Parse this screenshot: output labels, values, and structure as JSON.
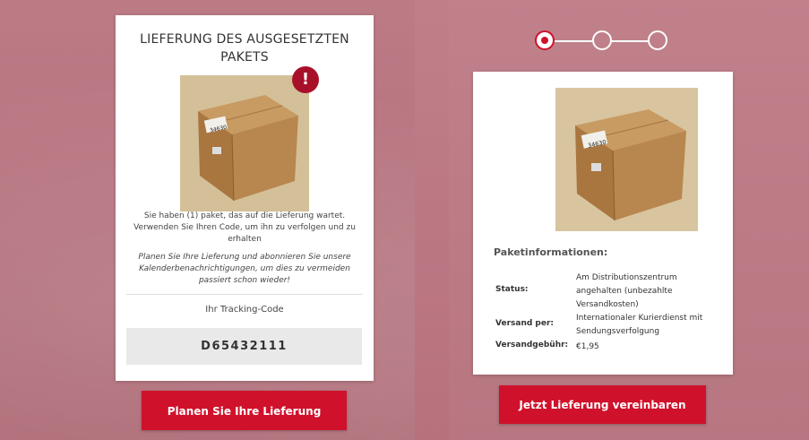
{
  "left_card": {
    "title": "LIEFERUNG DES AUSGESETZTEN PAKETS",
    "alert_symbol": "!",
    "message": "Sie haben (1) paket, das auf die Lieferung wartet. Verwenden Sie Ihren Code, um ihn zu verfolgen und zu erhalten",
    "reminder": "Planen Sie Ihre Lieferung und abonnieren Sie unsere Kalenderbenachrichtigungen, um dies zu vermeiden passiert schon wieder!",
    "tracking_label": "Ihr Tracking-Code",
    "tracking_code": "D65432111",
    "button_label": "Planen Sie Ihre Lieferung",
    "image_icon": "package-photo"
  },
  "stepper": {
    "steps": 3,
    "active_step": 1
  },
  "right_card": {
    "info_title": "Paketinformationen:",
    "rows": [
      {
        "key": "Status:",
        "value": "Am Distributionszentrum angehalten (unbezahlte Versandkosten)"
      },
      {
        "key": "Versand per:",
        "value": "Internationaler Kurierdienst mit Sendungsverfolgung"
      },
      {
        "key": "Versandgebühr:",
        "value": "€1,95"
      }
    ],
    "button_label": "Jetzt Lieferung vereinbaren"
  },
  "colors": {
    "accent": "#d0112b",
    "alert": "#a8102a",
    "background": "#b8727e"
  }
}
